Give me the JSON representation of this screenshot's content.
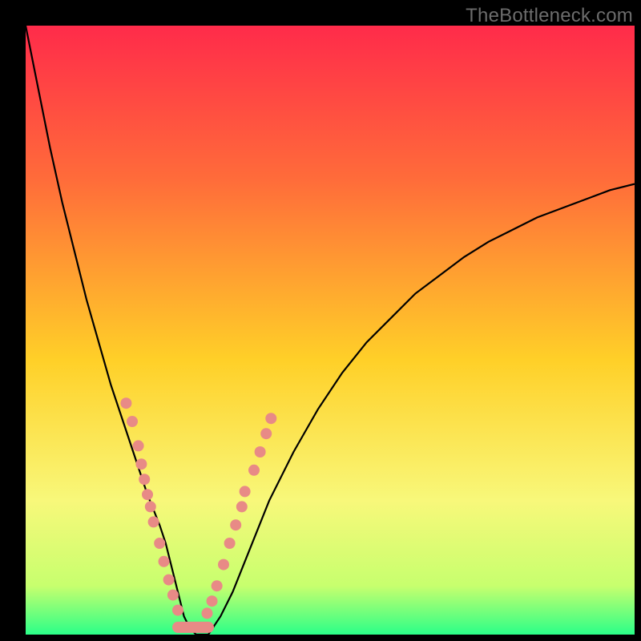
{
  "watermark": "TheBottleneck.com",
  "gradient_stops": [
    {
      "offset": "0%",
      "color": "#ff2b4a"
    },
    {
      "offset": "25%",
      "color": "#ff6b3a"
    },
    {
      "offset": "55%",
      "color": "#ffd028"
    },
    {
      "offset": "78%",
      "color": "#f8f87a"
    },
    {
      "offset": "92%",
      "color": "#c7ff6e"
    },
    {
      "offset": "100%",
      "color": "#2bff88"
    }
  ],
  "chart_data": {
    "type": "line",
    "title": "",
    "xlabel": "",
    "ylabel": "",
    "xlim": [
      0,
      100
    ],
    "ylim": [
      0,
      100
    ],
    "x": [
      0,
      2,
      4,
      6,
      8,
      10,
      12,
      14,
      16,
      18,
      20,
      22,
      23,
      24,
      25,
      26,
      27,
      28,
      29,
      30,
      32,
      34,
      36,
      38,
      40,
      44,
      48,
      52,
      56,
      60,
      64,
      68,
      72,
      76,
      80,
      84,
      88,
      92,
      96,
      100
    ],
    "values": [
      100,
      90,
      80,
      71,
      63,
      55,
      48,
      41,
      35,
      29,
      23,
      18,
      15,
      11,
      7,
      3,
      1,
      0,
      0,
      0,
      3,
      7,
      12,
      17,
      22,
      30,
      37,
      43,
      48,
      52,
      56,
      59,
      62,
      64.5,
      66.5,
      68.5,
      70,
      71.5,
      73,
      74
    ],
    "min_x": 27.5,
    "curve_color": "#000000",
    "cluster_points": [
      {
        "x": 16.5,
        "y": 38.0
      },
      {
        "x": 17.5,
        "y": 35.0
      },
      {
        "x": 18.5,
        "y": 31.0
      },
      {
        "x": 19.0,
        "y": 28.0
      },
      {
        "x": 19.5,
        "y": 25.5
      },
      {
        "x": 20.0,
        "y": 23.0
      },
      {
        "x": 20.5,
        "y": 21.0
      },
      {
        "x": 21.0,
        "y": 18.5
      },
      {
        "x": 22.0,
        "y": 15.0
      },
      {
        "x": 22.7,
        "y": 12.0
      },
      {
        "x": 23.5,
        "y": 9.0
      },
      {
        "x": 24.2,
        "y": 6.5
      },
      {
        "x": 25.0,
        "y": 4.0
      },
      {
        "x": 29.8,
        "y": 3.5
      },
      {
        "x": 30.6,
        "y": 5.5
      },
      {
        "x": 31.4,
        "y": 8.0
      },
      {
        "x": 32.5,
        "y": 11.5
      },
      {
        "x": 33.5,
        "y": 15.0
      },
      {
        "x": 34.5,
        "y": 18.0
      },
      {
        "x": 35.5,
        "y": 21.0
      },
      {
        "x": 36.0,
        "y": 23.5
      },
      {
        "x": 37.5,
        "y": 27.0
      },
      {
        "x": 38.5,
        "y": 30.0
      },
      {
        "x": 39.5,
        "y": 33.0
      },
      {
        "x": 40.3,
        "y": 35.5
      }
    ],
    "floor_segment": {
      "x1": 25.0,
      "x2": 30.0,
      "y": 1.2
    },
    "dot_color": "#e88a86",
    "dot_radius_px": 7
  }
}
